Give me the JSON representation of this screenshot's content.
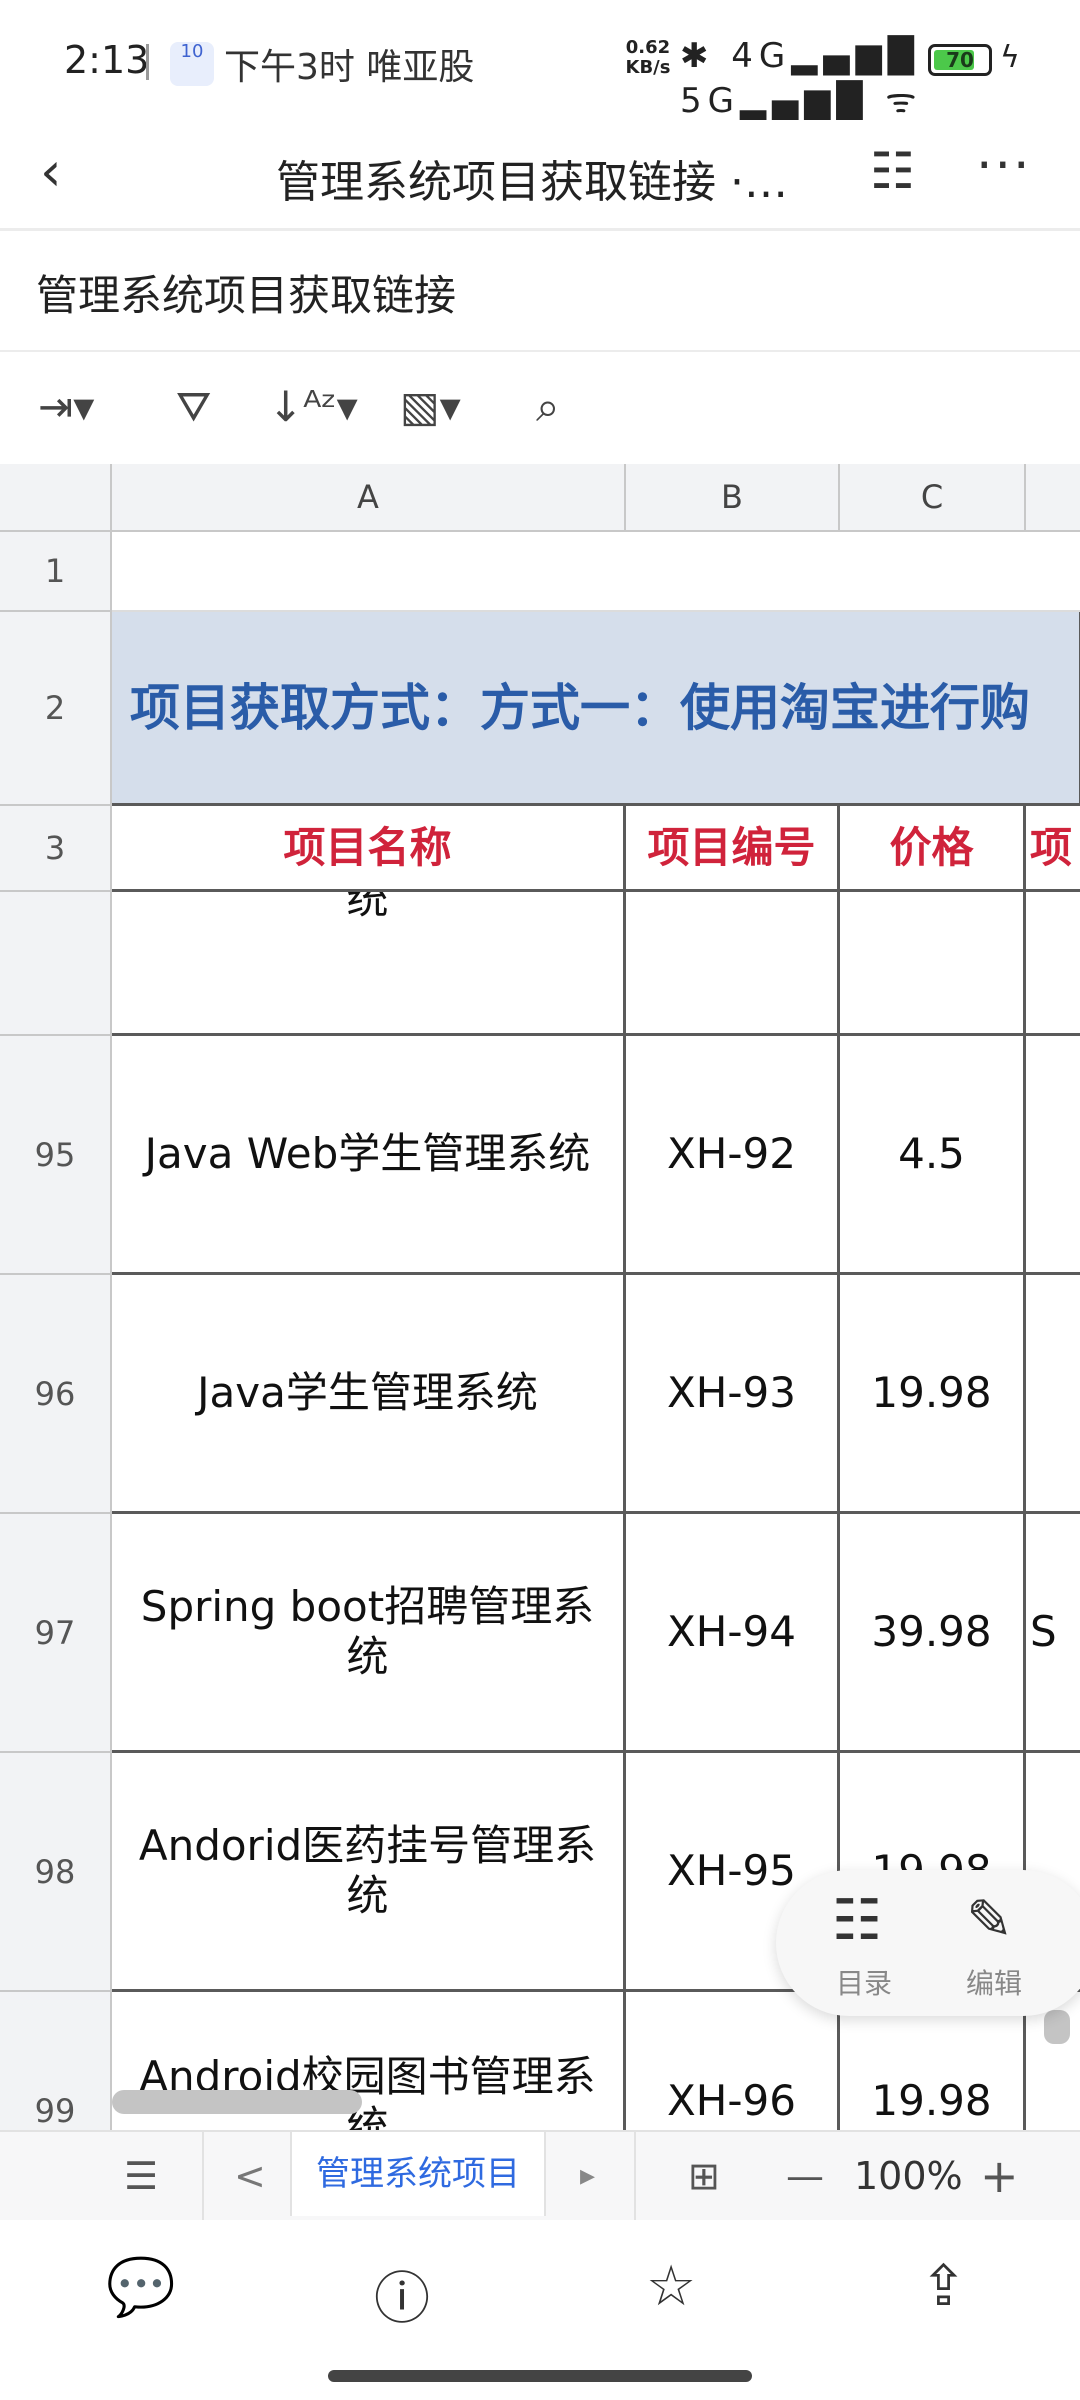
{
  "status_bar": {
    "time": "2:13",
    "notification_badge": "10",
    "notification_text": "下午3时 唯亚股",
    "net_speed_value": "0.62",
    "net_speed_unit": "KB/s",
    "signal_icons": "✱ 4G▂▄▆█ 5G▂▄▆█ ᯤ",
    "battery_level": "70"
  },
  "app_bar": {
    "back_icon": "‹",
    "title": "管理系统项目获取链接 ·…",
    "outline_icon": "☷",
    "more_icon": "···"
  },
  "document": {
    "name": "管理系统项目获取链接"
  },
  "toolbar": {
    "wrap_icon": "⇥▾",
    "filter_icon": "⛛",
    "sort_icon": "↓ᴬᶻ▾",
    "format_icon": "▧▾",
    "find_icon": "⌕"
  },
  "grid": {
    "columns": [
      "A",
      "B",
      "C"
    ],
    "row_numbers": [
      "1",
      "2",
      "3",
      "95",
      "96",
      "97",
      "98",
      "99"
    ],
    "banner_text": "项目获取方式：方式一：使用淘宝进行购",
    "headers": [
      "项目名称",
      "项目编号",
      "价格",
      "项"
    ],
    "partial_row_text": "统",
    "rows": [
      {
        "name": "Java Web学生管理系统",
        "code": "XH-92",
        "price": "4.5",
        "extra": ""
      },
      {
        "name": "Java学生管理系统",
        "code": "XH-93",
        "price": "19.98",
        "extra": ""
      },
      {
        "name": "Spring boot招聘管理系统",
        "code": "XH-94",
        "price": "39.98",
        "extra": "S"
      },
      {
        "name": "Andorid医药挂号管理系统",
        "code": "XH-95",
        "price": "19.98",
        "extra": ""
      },
      {
        "name": "Android校园图书管理系统",
        "code": "XH-96",
        "price": "19.98",
        "extra": ""
      }
    ]
  },
  "floating_menu": {
    "outline_label": "目录",
    "edit_label": "编辑",
    "outline_icon": "☷",
    "edit_icon": "✎"
  },
  "sheet_bar": {
    "list_icon": "☰",
    "prev_icon": "<",
    "tab_label": "管理系统项目",
    "next_icon": "▸",
    "freeze_icon": "⊞",
    "zoom_out_icon": "—",
    "zoom_level": "100%",
    "zoom_in_icon": "+"
  },
  "bottom_bar": {
    "comment_icon": "💬",
    "info_icon": "ⓘ",
    "star_icon": "☆",
    "share_icon": "⇪"
  }
}
